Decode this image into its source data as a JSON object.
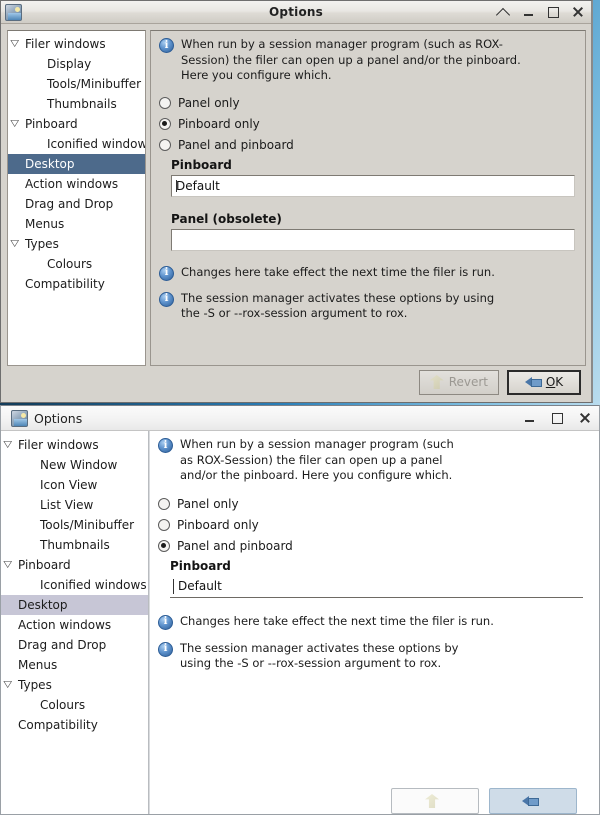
{
  "desktop": {
    "wallpaper_colors": [
      "#0d2030",
      "#2b7fb8",
      "#e8f2f8"
    ]
  },
  "window_top": {
    "title": "Options",
    "icon": "rox-options-icon",
    "focused": true,
    "titlebar_buttons": [
      {
        "name": "shade-button",
        "label": "^"
      },
      {
        "name": "minimize-button",
        "label": "_"
      },
      {
        "name": "maximize-button",
        "label": "□"
      },
      {
        "name": "close-button",
        "label": "×"
      }
    ],
    "tree": {
      "selected": "Desktop",
      "items": [
        {
          "label": "Filer windows",
          "depth": 0,
          "arrow": "▽",
          "selected": false
        },
        {
          "label": "Display",
          "depth": 1,
          "arrow": "",
          "selected": false
        },
        {
          "label": "Tools/Minibuffer",
          "depth": 1,
          "arrow": "",
          "selected": false
        },
        {
          "label": "Thumbnails",
          "depth": 1,
          "arrow": "",
          "selected": false
        },
        {
          "label": "Pinboard",
          "depth": 0,
          "arrow": "▽",
          "selected": false
        },
        {
          "label": "Iconified windows",
          "depth": 1,
          "arrow": "",
          "selected": false
        },
        {
          "label": "Desktop",
          "depth": 0,
          "arrow": "",
          "selected": true
        },
        {
          "label": "Action windows",
          "depth": 0,
          "arrow": "",
          "selected": false
        },
        {
          "label": "Drag and Drop",
          "depth": 0,
          "arrow": "",
          "selected": false
        },
        {
          "label": "Menus",
          "depth": 0,
          "arrow": "",
          "selected": false
        },
        {
          "label": "Types",
          "depth": 0,
          "arrow": "▽",
          "selected": false
        },
        {
          "label": "Colours",
          "depth": 1,
          "arrow": "",
          "selected": false
        },
        {
          "label": "Compatibility",
          "depth": 0,
          "arrow": "",
          "selected": false
        }
      ]
    },
    "content": {
      "intro_info": "When run by a session manager program (such as ROX-Session) the filer can open up a panel and/or the pinboard.  Here you configure which.",
      "radios": [
        {
          "label": "Panel only",
          "selected": false
        },
        {
          "label": "Pinboard only",
          "selected": true
        },
        {
          "label": "Panel and pinboard",
          "selected": false
        }
      ],
      "pinboard_heading": "Pinboard",
      "pinboard_value": "Default",
      "panel_heading": "Panel (obsolete)",
      "panel_value": "",
      "note_1": "Changes here take effect the next time the filer is run.",
      "note_2": "The session manager activates these options by using the -S or --rox-session argument to rox."
    },
    "buttons": {
      "revert": {
        "label": "Revert",
        "disabled": true,
        "icon": "revert-icon"
      },
      "ok": {
        "label": "OK",
        "mnemonic": "O",
        "default": true,
        "icon": "back-arrow-icon"
      }
    }
  },
  "window_bottom": {
    "title": "Options",
    "icon": "rox-options-icon",
    "focused": false,
    "titlebar_buttons": [
      {
        "name": "minimize-button",
        "label": "_"
      },
      {
        "name": "maximize-button",
        "label": "□"
      },
      {
        "name": "close-button",
        "label": "×"
      }
    ],
    "tree": {
      "selected": "Desktop",
      "items": [
        {
          "label": "Filer windows",
          "depth": 0,
          "arrow": "▽",
          "selected": false
        },
        {
          "label": "New Window",
          "depth": 1,
          "arrow": "",
          "selected": false
        },
        {
          "label": "Icon View",
          "depth": 1,
          "arrow": "",
          "selected": false
        },
        {
          "label": "List View",
          "depth": 1,
          "arrow": "",
          "selected": false
        },
        {
          "label": "Tools/Minibuffer",
          "depth": 1,
          "arrow": "",
          "selected": false
        },
        {
          "label": "Thumbnails",
          "depth": 1,
          "arrow": "",
          "selected": false
        },
        {
          "label": "Pinboard",
          "depth": 0,
          "arrow": "▽",
          "selected": false
        },
        {
          "label": "Iconified windows",
          "depth": 1,
          "arrow": "",
          "selected": false
        },
        {
          "label": "Desktop",
          "depth": 0,
          "arrow": "",
          "selected": true
        },
        {
          "label": "Action windows",
          "depth": 0,
          "arrow": "",
          "selected": false
        },
        {
          "label": "Drag and Drop",
          "depth": 0,
          "arrow": "",
          "selected": false
        },
        {
          "label": "Menus",
          "depth": 0,
          "arrow": "",
          "selected": false
        },
        {
          "label": "Types",
          "depth": 0,
          "arrow": "▽",
          "selected": false
        },
        {
          "label": "Colours",
          "depth": 1,
          "arrow": "",
          "selected": false
        },
        {
          "label": "Compatibility",
          "depth": 0,
          "arrow": "",
          "selected": false
        }
      ]
    },
    "content": {
      "intro_info": "When run by a session manager program (such as ROX-Session) the filer can open up a panel and/or the pinboard.  Here you configure which.",
      "radios": [
        {
          "label": "Panel only",
          "selected": false
        },
        {
          "label": "Pinboard only",
          "selected": false
        },
        {
          "label": "Panel and pinboard",
          "selected": true
        }
      ],
      "pinboard_heading": "Pinboard",
      "pinboard_value": "Default",
      "note_1": "Changes here take effect the next time the filer is run.",
      "note_2": "The session manager activates these options by using the -S or --rox-session argument to rox."
    },
    "buttons": {
      "revert": {
        "label": "",
        "disabled": true,
        "icon": "revert-icon"
      },
      "ok": {
        "label": "",
        "default": true,
        "icon": "back-arrow-icon"
      }
    }
  }
}
